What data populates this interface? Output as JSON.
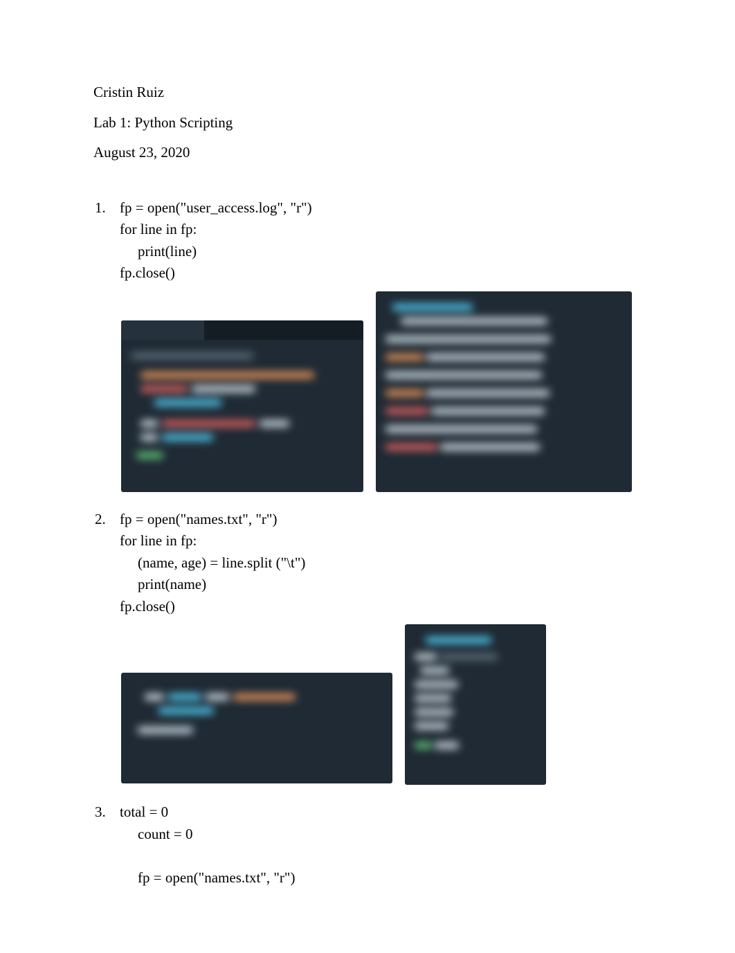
{
  "header": {
    "author": "Cristin Ruiz",
    "title": "Lab 1: Python Scripting",
    "date": "August 23, 2020"
  },
  "items": [
    {
      "num": "1.",
      "lines": [
        {
          "text": "fp = open(\"user_access.log\", \"r\")",
          "indent": 0
        },
        {
          "text": "for line in fp:",
          "indent": 0
        },
        {
          "text": "print(line)",
          "indent": 1
        },
        {
          "text": "fp.close()",
          "indent": 0
        }
      ]
    },
    {
      "num": "2.",
      "lines": [
        {
          "text": "fp = open(\"names.txt\", \"r\")",
          "indent": 0
        },
        {
          "text": "for line in fp:",
          "indent": 0
        },
        {
          "text": "(name, age) = line.split (\"\\t\")",
          "indent": 1
        },
        {
          "text": "print(name)",
          "indent": 1
        },
        {
          "text": "fp.close()",
          "indent": 0
        }
      ]
    },
    {
      "num": "3.",
      "lines": [
        {
          "text": "total = 0",
          "indent": 0
        },
        {
          "text": "count = 0",
          "indent": 1
        },
        {
          "text": "",
          "indent": 0
        },
        {
          "text": "fp = open(\"names.txt\", \"r\")",
          "indent": 1
        }
      ]
    }
  ]
}
